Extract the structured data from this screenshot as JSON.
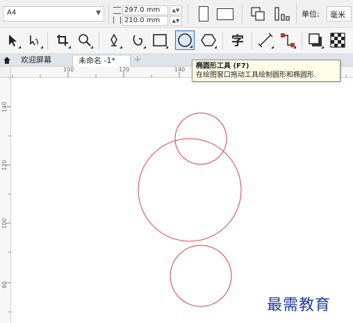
{
  "property_bar": {
    "paper_size": "A4",
    "width_value": "297.0 mm",
    "height_value": "210.0 mm",
    "units_label": "单位:",
    "units_value": "毫米"
  },
  "toolbox": {
    "tools": [
      {
        "name": "pick-tool",
        "icon": "arrow-pointer-icon"
      },
      {
        "name": "shape-tool",
        "icon": "shape-node-icon"
      },
      {
        "name": "crop-tool",
        "icon": "crop-icon"
      },
      {
        "name": "zoom-tool",
        "icon": "magnifier-icon"
      },
      {
        "name": "pen-tool",
        "icon": "pen-nib-icon"
      },
      {
        "name": "freehand-tool",
        "icon": "spiral-curve-icon"
      },
      {
        "name": "rectangle-tool",
        "icon": "rectangle-icon"
      },
      {
        "name": "ellipse-tool",
        "icon": "ellipse-icon",
        "active": true
      },
      {
        "name": "polygon-tool",
        "icon": "hexagon-icon"
      },
      {
        "name": "text-tool",
        "icon": "text-character-icon",
        "label": "字"
      },
      {
        "name": "parallel-dimension-tool",
        "icon": "dimension-line-icon"
      },
      {
        "name": "connector-tool",
        "icon": "connector-icon"
      },
      {
        "name": "drop-shadow-tool",
        "icon": "drop-shadow-icon"
      },
      {
        "name": "transparency-tool",
        "icon": "checkerboard-icon"
      }
    ]
  },
  "tabs": [
    {
      "label": "欢迎屏幕",
      "active": false
    },
    {
      "label": "未命名 -1*",
      "active": true
    }
  ],
  "tooltip": {
    "title": "椭圆形工具 (F7)",
    "description": "在绘图窗口拖动工具绘制圆形和椭圆形."
  },
  "rulers": {
    "top_labels": [
      "100",
      "120",
      "140"
    ],
    "left_labels": [
      "140",
      "120",
      "100",
      "80"
    ]
  },
  "watermark": "最需教育",
  "colors": {
    "circle_stroke": "#e23a3a",
    "active_tool_border": "#2a6fbf"
  }
}
